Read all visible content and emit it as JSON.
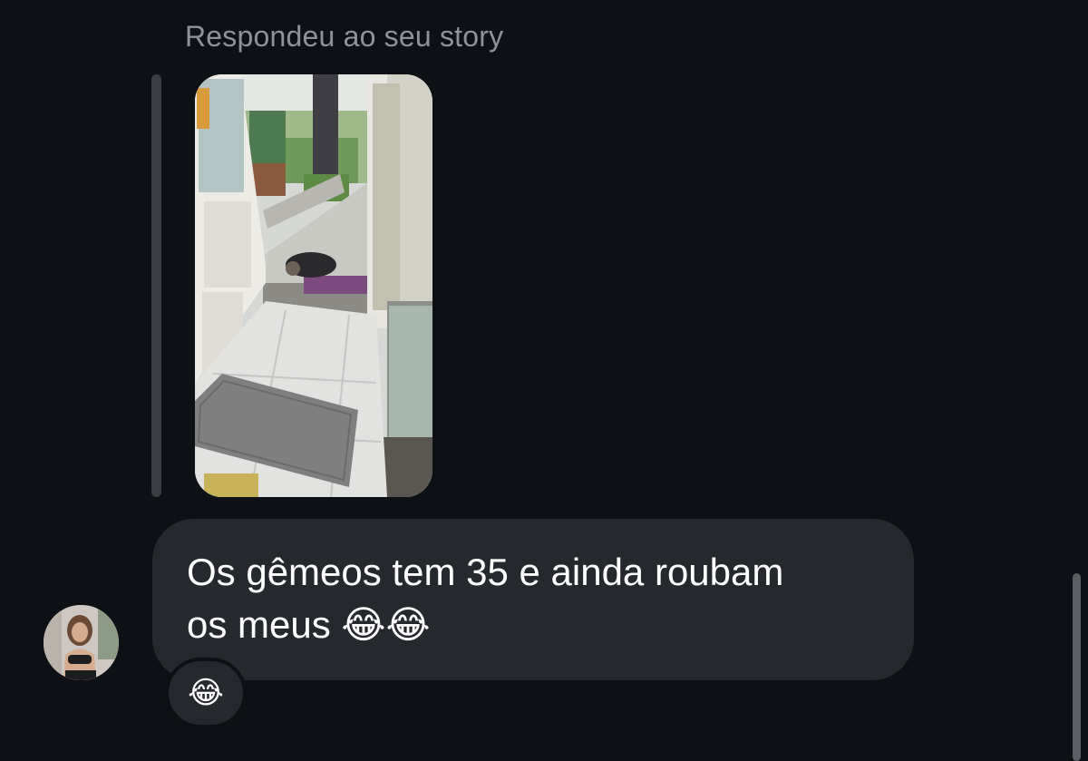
{
  "conversation": {
    "reply_label": "Respondeu ao seu story",
    "story_preview": {
      "icon": "story-image"
    },
    "message": {
      "text": "Os gêmeos tem 35 e ainda roubam\nos meus 😂😂"
    },
    "reaction": {
      "emoji": "😂"
    },
    "sender_avatar": {
      "icon": "profile-photo"
    }
  },
  "colors": {
    "background": "#0d1014",
    "bubble": "#25282d",
    "secondary_text": "#8e9399",
    "quote_bar": "#3a3d42"
  }
}
